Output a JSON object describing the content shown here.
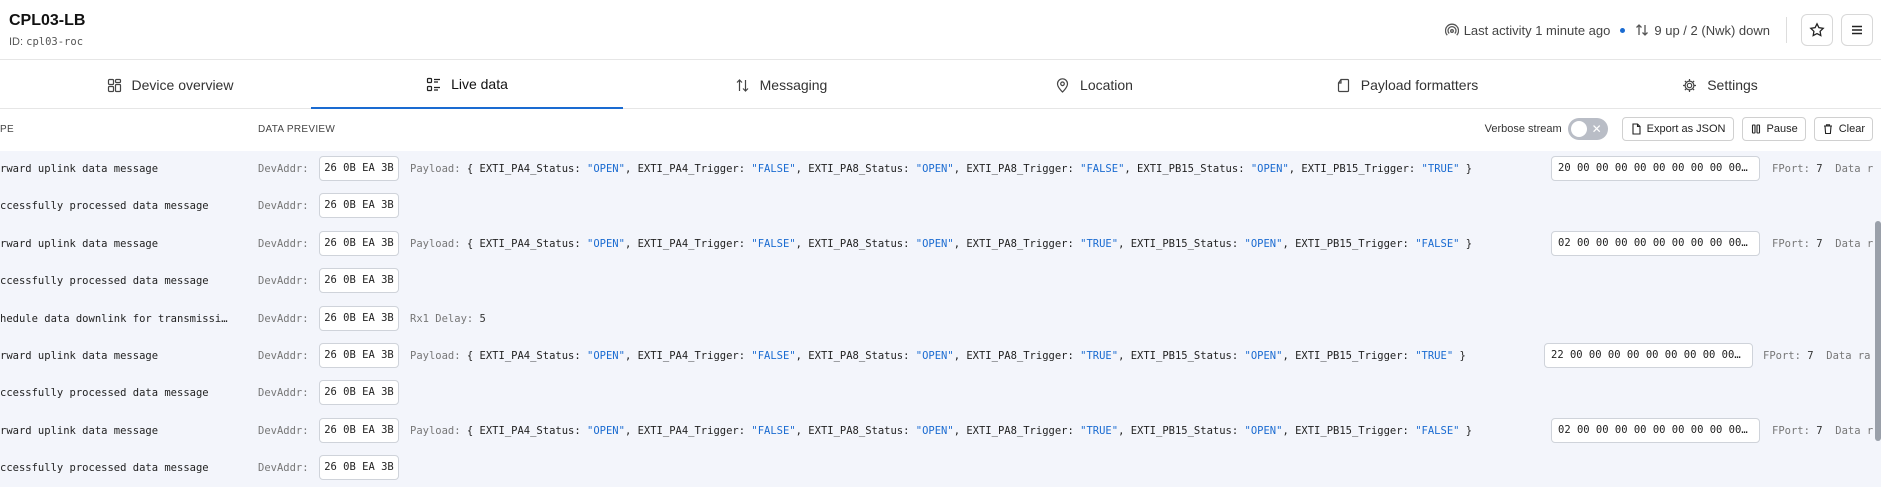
{
  "device": {
    "title": "CPL03-LB",
    "id_label": "ID:",
    "id_value": "cpl03-roc"
  },
  "header": {
    "activity": "Last activity 1 minute ago",
    "counts": "9 up / 2 (Nwk) down"
  },
  "tabs": [
    {
      "label": "Device overview",
      "icon": "grid-icon"
    },
    {
      "label": "Live data",
      "icon": "list-icon",
      "active": true
    },
    {
      "label": "Messaging",
      "icon": "arrows-updown-icon"
    },
    {
      "label": "Location",
      "icon": "pin-icon"
    },
    {
      "label": "Payload formatters",
      "icon": "code-file-icon"
    },
    {
      "label": "Settings",
      "icon": "gear-icon"
    }
  ],
  "toolbar": {
    "col_type": "PE",
    "col_preview": "DATA PREVIEW",
    "verbose_label": "Verbose stream",
    "export_label": "Export as JSON",
    "pause_label": "Pause",
    "clear_label": "Clear"
  },
  "labels": {
    "devaddr": "DevAddr:",
    "payload": "Payload:",
    "fport": "FPort:",
    "dataRate": "Data r",
    "dataRateLong": "Data ra",
    "rx1": "Rx1 Delay:"
  },
  "events": [
    {
      "type": "rward uplink data message",
      "devaddr": "26 0B EA 3B",
      "payload_kind": "uplink",
      "payload": {
        "pa4_status": "\"OPEN\"",
        "pa4_trigger": "\"FALSE\"",
        "pa8_status": "\"OPEN\"",
        "pa8_trigger": "\"FALSE\"",
        "pb15_status": "\"OPEN\"",
        "pb15_trigger": "\"TRUE\""
      },
      "raw": "20 00 00 00 00 00 00 00 00 00…",
      "fport": "7"
    },
    {
      "type": "ccessfully processed data message",
      "devaddr": "26 0B EA 3B",
      "payload_kind": "none"
    },
    {
      "type": "rward uplink data message",
      "devaddr": "26 0B EA 3B",
      "payload_kind": "uplink",
      "payload": {
        "pa4_status": "\"OPEN\"",
        "pa4_trigger": "\"FALSE\"",
        "pa8_status": "\"OPEN\"",
        "pa8_trigger": "\"TRUE\"",
        "pb15_status": "\"OPEN\"",
        "pb15_trigger": "\"FALSE\""
      },
      "raw": "02 00 00 00 00 00 00 00 00 00…",
      "fport": "7"
    },
    {
      "type": "ccessfully processed data message",
      "devaddr": "26 0B EA 3B",
      "payload_kind": "none"
    },
    {
      "type": "hedule data downlink for transmissi…",
      "devaddr": "26 0B EA 3B",
      "payload_kind": "rx",
      "rx1": "5"
    },
    {
      "type": "rward uplink data message",
      "devaddr": "26 0B EA 3B",
      "payload_kind": "uplink",
      "payload": {
        "pa4_status": "\"OPEN\"",
        "pa4_trigger": "\"FALSE\"",
        "pa8_status": "\"OPEN\"",
        "pa8_trigger": "\"TRUE\"",
        "pb15_status": "\"OPEN\"",
        "pb15_trigger": "\"TRUE\""
      },
      "raw": "22 00 00 00 00 00 00 00 00 00…",
      "fport": "7"
    },
    {
      "type": "ccessfully processed data message",
      "devaddr": "26 0B EA 3B",
      "payload_kind": "none"
    },
    {
      "type": "rward uplink data message",
      "devaddr": "26 0B EA 3B",
      "payload_kind": "uplink",
      "payload": {
        "pa4_status": "\"OPEN\"",
        "pa4_trigger": "\"FALSE\"",
        "pa8_status": "\"OPEN\"",
        "pa8_trigger": "\"TRUE\"",
        "pb15_status": "\"OPEN\"",
        "pb15_trigger": "\"FALSE\""
      },
      "raw": "02 00 00 00 00 00 00 00 00 00…",
      "fport": "7"
    },
    {
      "type": "ccessfully processed data message",
      "devaddr": "26 0B EA 3B",
      "payload_kind": "none"
    }
  ]
}
